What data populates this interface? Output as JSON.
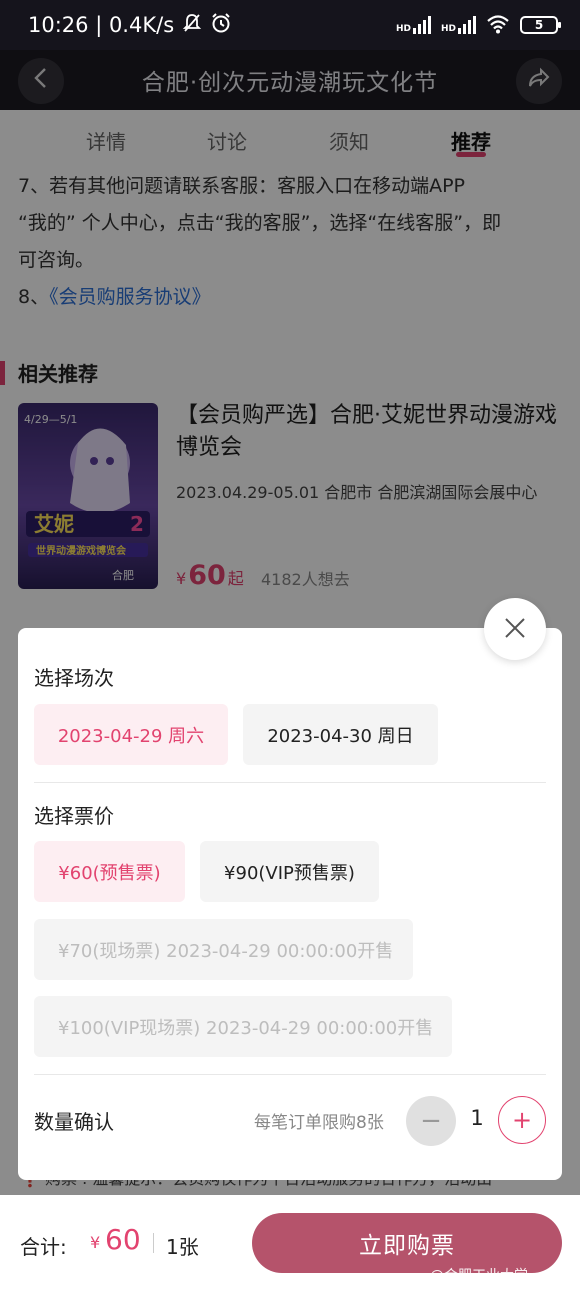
{
  "status_bar": {
    "time_speed": "10:26 | 0.4K/s",
    "hd1": "HD",
    "hd2": "HD",
    "battery": "5"
  },
  "header": {
    "title": "合肥·创次元动漫潮玩文化节"
  },
  "tabs": [
    "详情",
    "讨论",
    "须知",
    "推荐"
  ],
  "notice": {
    "line1": "7、若有其他问题请联系客服：客服入口在移动端APP",
    "line2": "“我的” 个人中心，点击“我的客服”，选择“在线客服”，即",
    "line3": "可咨询。",
    "item8_prefix": "8、",
    "item8_link": "《会员购服务协议》"
  },
  "recommend": {
    "section_title": "相关推荐",
    "title": "【会员购严选】合肥·艾妮世界动漫游戏博览会",
    "meta": "2023.04.29-05.01   合肥市   合肥滨湖国际会展中心",
    "price_currency": "¥",
    "price_value": "60",
    "price_suffix": "起",
    "want": "4182人想去",
    "poster_date": "4/29—5/1",
    "poster_title": "艾妮",
    "poster_num": "2",
    "poster_sub": "世界动漫游戏博览会",
    "poster_city": "合肥"
  },
  "modal": {
    "session_label": "选择场次",
    "sessions": [
      {
        "label": "2023-04-29 周六",
        "state": "selected"
      },
      {
        "label": "2023-04-30 周日",
        "state": "normal"
      }
    ],
    "price_label": "选择票价",
    "prices": [
      {
        "label": "¥60(预售票)",
        "state": "selected"
      },
      {
        "label": "¥90(VIP预售票)",
        "state": "normal"
      },
      {
        "label": "¥70(现场票) 2023-04-29 00:00:00开售",
        "state": "disabled"
      },
      {
        "label": "¥100(VIP现场票) 2023-04-29 00:00:00开售",
        "state": "disabled"
      }
    ],
    "quantity_label": "数量确认",
    "limit_text": "每笔订单限购8张",
    "minus": "−",
    "quantity": "1",
    "plus": "+"
  },
  "bottom": {
    "peek_text": "❗ 购票 . 温馨提示：会员购仅作为平台活动服务的合作方，活动由",
    "total_label": "合计:",
    "currency": "¥",
    "total": "60",
    "count": "1张",
    "buy_label": "立即购票",
    "watermark": "@合肥工业大学"
  },
  "colors": {
    "accent": "#e2436f",
    "buy_button": "#b5536b",
    "header_bg": "#1c1b22"
  }
}
